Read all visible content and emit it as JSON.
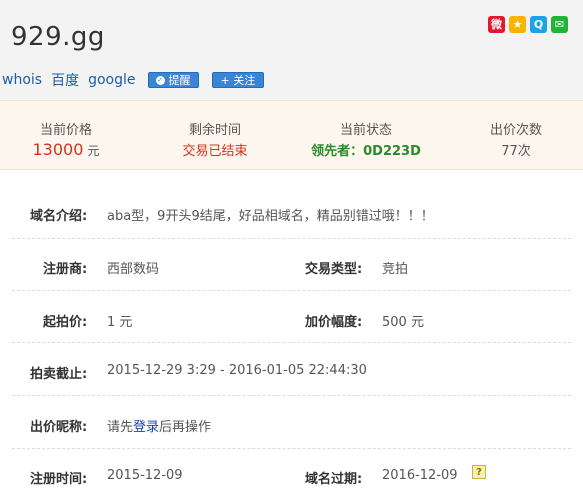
{
  "header": {
    "domain": "929.gg",
    "links": {
      "whois": "whois",
      "baidu": "百度",
      "google": "google"
    },
    "buttons": {
      "remind": "提醒",
      "follow": "+ 关注"
    }
  },
  "share_icons": [
    "weibo-icon",
    "qzone-icon",
    "tencent-weibo-icon",
    "wechat-icon"
  ],
  "status": {
    "price_label": "当前价格",
    "price_value": "13000",
    "price_unit": "元",
    "time_label": "剩余时间",
    "time_value": "交易已结束",
    "state_label": "当前状态",
    "state_value": "领先者：0D223D",
    "bids_label": "出价次数",
    "bids_value": "77次"
  },
  "details": {
    "intro_label": "域名介绍:",
    "intro_value": "aba型，9开头9结尾，好品相域名，精品别错过哦！！！",
    "registrar_label": "注册商:",
    "registrar_value": "西部数码",
    "trade_type_label": "交易类型:",
    "trade_type_value": "竞拍",
    "start_price_label": "起拍价:",
    "start_price_value": "1 元",
    "increment_label": "加价幅度:",
    "increment_value": "500 元",
    "auction_end_label": "拍卖截止:",
    "auction_end_value": "2015-12-29 3:29 - 2016-01-05 22:44:30",
    "bid_nick_label": "出价昵称:",
    "bid_nick_prefix": "请先",
    "bid_nick_login": "登录",
    "bid_nick_suffix": "后再操作",
    "reg_time_label": "注册时间:",
    "reg_time_value": "2015-12-09",
    "expire_label": "域名过期:",
    "expire_value": "2016-12-09"
  },
  "colors": {
    "accent_red": "#d4321f",
    "accent_green": "#2a8a2a",
    "link_blue": "#1d5fa8",
    "status_bg": "#fdf6ee"
  }
}
